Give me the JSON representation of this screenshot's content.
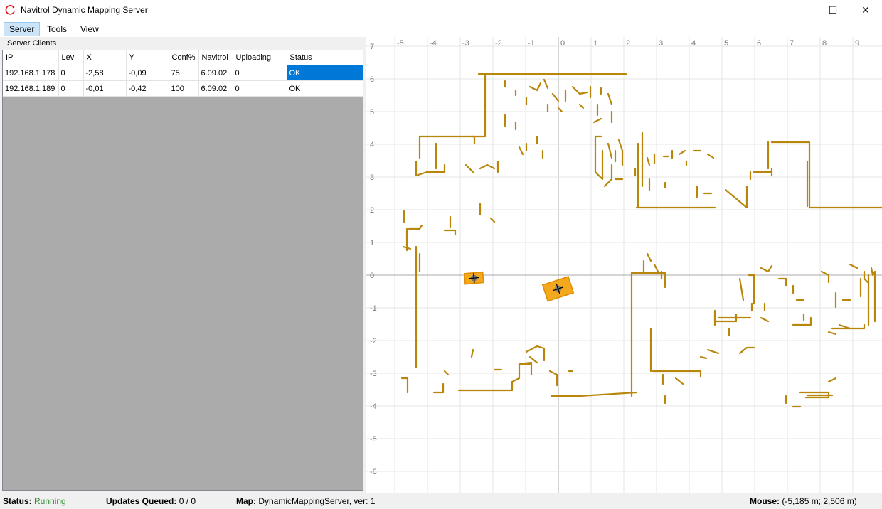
{
  "window": {
    "title": "Navitrol Dynamic Mapping Server",
    "controls": {
      "minimize": "—",
      "maximize": "☐",
      "close": "✕"
    }
  },
  "menu": {
    "items": [
      "Server",
      "Tools",
      "View"
    ],
    "active": "Server"
  },
  "clients_panel": {
    "label": "Server Clients",
    "columns": [
      "IP",
      "Lev",
      "X",
      "Y",
      "Conf%",
      "Navitrol",
      "Uploading",
      "Status"
    ],
    "rows": [
      [
        "192.168.1.178",
        "0",
        "-2,58",
        "-0,09",
        "75",
        "6.09.02",
        "0",
        "OK"
      ],
      [
        "192.168.1.189",
        "0",
        "-0,01",
        "-0,42",
        "100",
        "6.09.02",
        "0",
        "OK"
      ]
    ],
    "selected_row": 0
  },
  "map": {
    "x_ticks": [
      "-5",
      "-4",
      "-3",
      "-2",
      "-1",
      "0",
      "1",
      "2",
      "3",
      "4",
      "5",
      "6",
      "7",
      "8",
      "9"
    ],
    "y_ticks": [
      "7",
      "6",
      "5",
      "4",
      "3",
      "2",
      "1",
      "0",
      "-1",
      "-2",
      "-3",
      "-4",
      "-5",
      "-6"
    ],
    "wall_color": "#b8860b",
    "robot_color": "#f4a81d",
    "robots": [
      {
        "x": -2.58,
        "y": -0.09
      },
      {
        "x": -0.01,
        "y": -0.42
      }
    ]
  },
  "status": {
    "status_label": "Status:",
    "status_value": "Running",
    "queue_label": "Updates Queued:",
    "queue_value": "0 / 0",
    "map_label": "Map:",
    "map_value": "DynamicMappingServer, ver: 1",
    "mouse_label": "Mouse:",
    "mouse_value": "(-5,185 m; 2,506 m)"
  }
}
